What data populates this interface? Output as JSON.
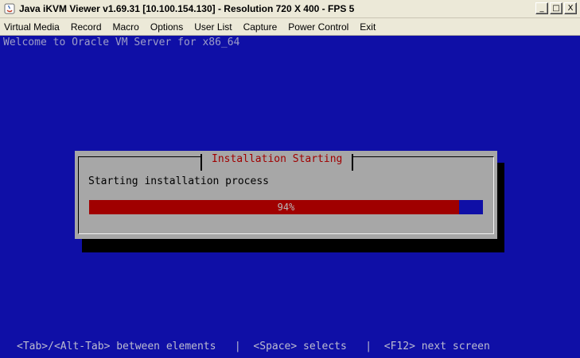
{
  "window": {
    "title": "Java iKVM Viewer v1.69.31 [10.100.154.130]  - Resolution 720 X 400 - FPS 5",
    "controls": {
      "minimize": "_",
      "maximize": "□",
      "close": "X"
    }
  },
  "menu": {
    "items": [
      "Virtual Media",
      "Record",
      "Macro",
      "Options",
      "User List",
      "Capture",
      "Power Control",
      "Exit"
    ]
  },
  "console": {
    "welcome": "Welcome to Oracle VM Server for x86_64",
    "dialog": {
      "title": "Installation Starting",
      "message": "Starting installation process",
      "progress_percent": 94,
      "progress_label": "94%"
    },
    "hints": "<Tab>/<Alt-Tab> between elements   |  <Space> selects   |  <F12> next screen"
  },
  "colors": {
    "console_bg": "#0f0fa6",
    "dialog_bg": "#a7a7a7",
    "dialog_title": "#a00000",
    "progress_fill": "#a00000",
    "progress_track": "#0f0fa6"
  },
  "icons": {
    "app": "java-icon"
  }
}
